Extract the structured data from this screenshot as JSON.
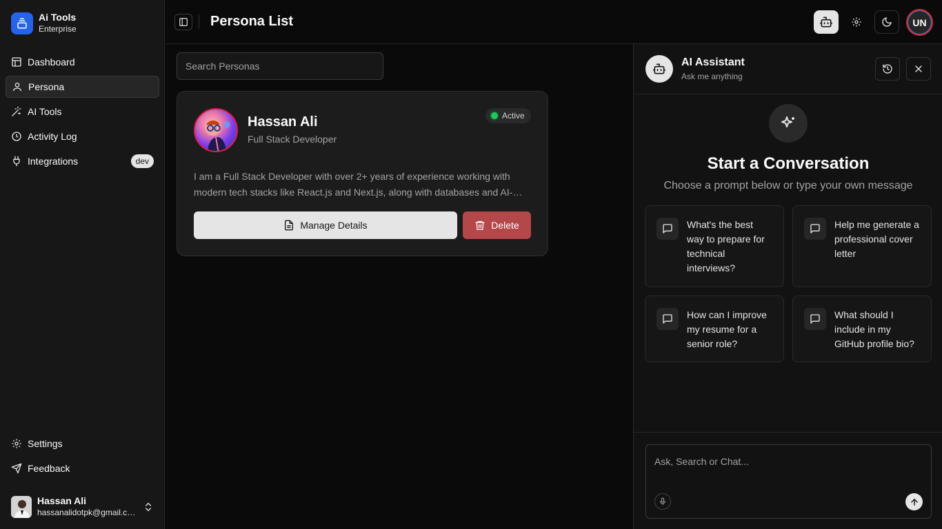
{
  "app": {
    "name": "Ai Tools",
    "plan": "Enterprise"
  },
  "sidebar": {
    "items": [
      {
        "label": "Dashboard",
        "icon": "layout-icon"
      },
      {
        "label": "Persona",
        "icon": "user-icon",
        "active": true
      },
      {
        "label": "AI Tools",
        "icon": "wand-icon"
      },
      {
        "label": "Activity Log",
        "icon": "clock-icon"
      },
      {
        "label": "Integrations",
        "icon": "plug-icon",
        "badge": "dev"
      }
    ],
    "bottom": [
      {
        "label": "Settings",
        "icon": "gear-icon"
      },
      {
        "label": "Feedback",
        "icon": "send-icon"
      }
    ],
    "user": {
      "name": "Hassan Ali",
      "email": "hassanalidotpk@gmail.com"
    }
  },
  "header": {
    "title": "Persona List",
    "avatar_initials": "UN"
  },
  "search": {
    "placeholder": "Search Personas"
  },
  "persona": {
    "name": "Hassan Ali",
    "role": "Full Stack Developer",
    "status": "Active",
    "description": "I am a Full Stack Developer with over 2+ years of experience working with modern tech stacks like React.js and Next.js, along with databases and AI-powered tools.",
    "manage_label": "Manage Details",
    "delete_label": "Delete"
  },
  "assistant": {
    "title": "AI Assistant",
    "subtitle": "Ask me anything",
    "heading": "Start a Conversation",
    "subheading": "Choose a prompt below or type your own message",
    "prompts": [
      "What's the best way to prepare for technical interviews?",
      "Help me generate a professional cover letter",
      "How can I improve my resume for a senior role?",
      "What should I include in my GitHub profile bio?"
    ],
    "input_placeholder": "Ask, Search or Chat..."
  },
  "colors": {
    "background": "#0a0a0a",
    "sidebar": "#171717",
    "brand": "#2563eb",
    "status_active": "#22c55e",
    "danger": "#b3474a"
  }
}
